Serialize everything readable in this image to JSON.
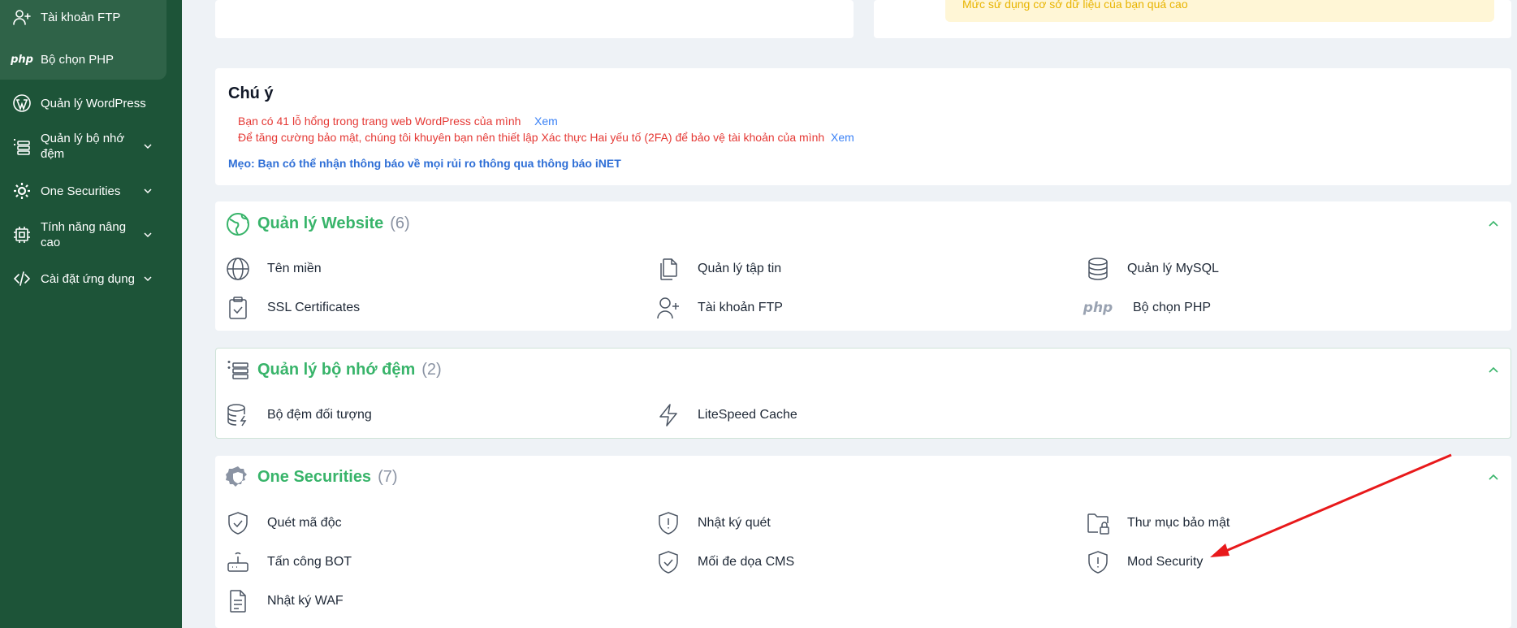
{
  "sidebar": {
    "items": [
      {
        "label": "Tài khoản FTP",
        "icon": "user-plus-icon"
      },
      {
        "label": "Bộ chọn PHP",
        "icon": "php-icon"
      },
      {
        "label": "Quản lý WordPress",
        "icon": "wordpress-icon"
      },
      {
        "label": "Quản lý bộ nhớ đệm",
        "icon": "cache-icon"
      },
      {
        "label": "One Securities",
        "icon": "gear-icon"
      },
      {
        "label": "Tính năng nâng cao",
        "icon": "cpu-icon"
      },
      {
        "label": "Cài đặt ứng dụng",
        "icon": "code-icon"
      }
    ],
    "php_text": "php"
  },
  "warning": {
    "text": "Mức sử dụng cơ sở dữ liệu của bạn quá cao"
  },
  "notice": {
    "title": "Chú ý",
    "line1": "Bạn có 41 lỗ hổng trong trang web WordPress của mình",
    "line2": "Để tăng cường bảo mật, chúng tôi khuyên bạn nên thiết lập Xác thực Hai yếu tố (2FA) để bảo vệ tài khoản của mình",
    "link": "Xem",
    "tip": "Mẹo: Bạn có thể nhận thông báo về mọi rủi ro thông qua thông báo iNET"
  },
  "website": {
    "title": "Quản lý Website",
    "count": "(6)",
    "items": [
      "Tên miền",
      "Quản lý tập tin",
      "Quản lý MySQL",
      "SSL Certificates",
      "Tài khoản FTP",
      "Bộ chọn PHP"
    ]
  },
  "cache": {
    "title": "Quản lý bộ nhớ đệm",
    "count": "(2)",
    "items": [
      "Bộ đệm đối tượng",
      "LiteSpeed Cache"
    ]
  },
  "security": {
    "title": "One Securities",
    "count": "(7)",
    "items": [
      "Quét mã độc",
      "Nhật ký quét",
      "Thư mục bảo mật",
      "Tấn công BOT",
      "Mối đe dọa CMS",
      "Mod Security",
      "Nhật ký WAF"
    ]
  },
  "colors": {
    "sidebar": "#1d5438",
    "accent": "#38b46a",
    "alert": "#e53935",
    "link": "#3b82f6",
    "annotation": "#e8191b"
  }
}
